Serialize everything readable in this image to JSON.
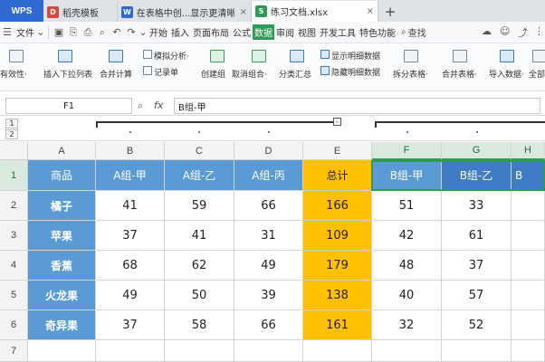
{
  "tabs": [
    {
      "label": "稻壳模板",
      "color": "#d9473b",
      "glyph": "D",
      "active": false
    },
    {
      "label": "在表格中创...显示更清晰",
      "color": "#2f6ad0",
      "glyph": "W",
      "active": false
    },
    {
      "label": "练习文档.xlsx",
      "color": "#2e9b57",
      "glyph": "S",
      "active": true
    }
  ],
  "app_button": "WPS",
  "tab_close": "×",
  "tab_add": "+",
  "menu": {
    "file": "文件",
    "file_arrow": "⌄",
    "items": [
      "开始",
      "插入",
      "页面布局",
      "公式",
      "数据",
      "审阅",
      "视图",
      "开发工具",
      "特色功能"
    ],
    "active": "数据",
    "search": "查找"
  },
  "ribbon": {
    "items": [
      {
        "label": "有效性·"
      },
      {
        "label": "插入下拉列表"
      },
      {
        "label": "合并计算"
      },
      {
        "label": "模拟分析·"
      },
      {
        "label": "记录单"
      },
      {
        "label": "创建组"
      },
      {
        "label": "取消组合·"
      },
      {
        "label": "分类汇总"
      },
      {
        "label": "显示明细数据"
      },
      {
        "label": "隐藏明细数据"
      },
      {
        "label": "拆分表格·"
      },
      {
        "label": "合并表格·"
      },
      {
        "label": "导入数据·"
      },
      {
        "label": "全部"
      }
    ]
  },
  "formula_bar": {
    "cell_ref": "F1",
    "fx": "fx",
    "value": "B组-甲"
  },
  "outline": {
    "level1": "1",
    "level2": "2",
    "minus": "-"
  },
  "columns": [
    "A",
    "B",
    "C",
    "D",
    "E",
    "F",
    "G",
    "H"
  ],
  "rows": [
    "1",
    "2",
    "3",
    "4",
    "5",
    "6",
    "7"
  ],
  "colors": {
    "header_blue": "#5b9bd5",
    "product_blue": "#5b9bd5",
    "total_orange": "#ffc000",
    "selected_header": "#3f7cc4",
    "selection_green": "#2e9b57"
  },
  "table": {
    "header": [
      "商品",
      "A组-甲",
      "A组-乙",
      "A组-丙",
      "总计",
      "B组-甲",
      "B组-乙",
      "B"
    ],
    "rows": [
      [
        "橘子",
        "41",
        "59",
        "66",
        "166",
        "51",
        "33"
      ],
      [
        "苹果",
        "37",
        "41",
        "31",
        "109",
        "42",
        "61"
      ],
      [
        "香蕉",
        "68",
        "62",
        "49",
        "179",
        "48",
        "37"
      ],
      [
        "火龙果",
        "49",
        "50",
        "39",
        "138",
        "40",
        "57"
      ],
      [
        "奇异果",
        "37",
        "58",
        "66",
        "161",
        "32",
        "52"
      ]
    ]
  }
}
